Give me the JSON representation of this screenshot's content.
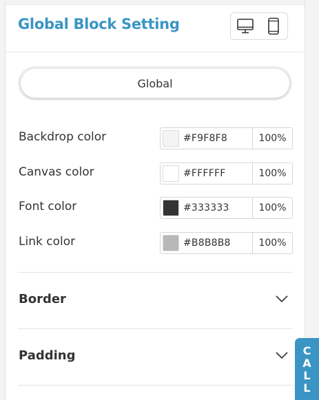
{
  "header": {
    "title": "Global Block Setting"
  },
  "device_toggle": {
    "items": [
      {
        "icon": "desktop-icon"
      },
      {
        "icon": "mobile-icon"
      }
    ]
  },
  "scope_tab": {
    "label": "Global"
  },
  "colors": [
    {
      "label": "Backdrop color",
      "hex": "#F9F8F8",
      "opacity": "100%",
      "swatch": "#f5f4f4"
    },
    {
      "label": "Canvas color",
      "hex": "#FFFFFF",
      "opacity": "100%",
      "swatch": "#ffffff"
    },
    {
      "label": "Font color",
      "hex": "#333333",
      "opacity": "100%",
      "swatch": "#333333"
    },
    {
      "label": "Link color",
      "hex": "#B8B8B8",
      "opacity": "100%",
      "swatch": "#b8b8b8"
    }
  ],
  "sections": [
    {
      "label": "Border",
      "icon": "chevron-down-icon"
    },
    {
      "label": "Padding",
      "icon": "chevron-down-icon"
    }
  ],
  "call_tab": {
    "letters": [
      "C",
      "A",
      "L",
      "L"
    ]
  },
  "theme": {
    "accent": "#3a95c4",
    "text": "#333333",
    "border": "#d6d6d6"
  }
}
